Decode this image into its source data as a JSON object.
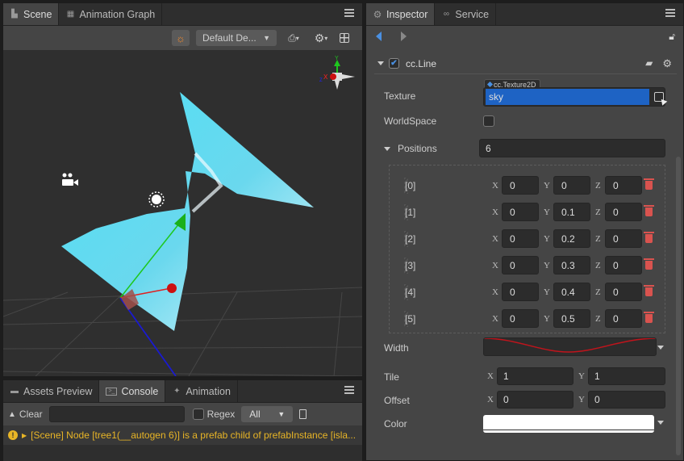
{
  "scene_panel": {
    "tabs": [
      {
        "label": "Scene",
        "icon": "scene-icon",
        "active": true
      },
      {
        "label": "Animation Graph",
        "icon": "animation-graph-icon",
        "active": false
      }
    ],
    "toolbar": {
      "light_icon": "sun-icon",
      "layout_select": "Default De...",
      "camera_menu_icon": "camera-icon",
      "settings_icon": "gear-icon",
      "layout_icon": "grid-icon"
    },
    "gizmo": {
      "y_label": "Y",
      "x_label": "X",
      "z_label": "Z"
    }
  },
  "console_panel": {
    "tabs": [
      {
        "label": "Assets Preview",
        "icon": "folder-icon",
        "active": false
      },
      {
        "label": "Console",
        "icon": "console-icon",
        "active": true
      },
      {
        "label": "Animation",
        "icon": "animation-icon",
        "active": false
      }
    ],
    "clear_label": "Clear",
    "search_value": "",
    "regex_label": "Regex",
    "regex_checked": false,
    "filter_value": "All",
    "logs": [
      {
        "level": "warning",
        "text": "[Scene] Node [tree1(__autogen 6)] is a prefab child of prefabInstance [isla..."
      }
    ]
  },
  "inspector": {
    "tabs": [
      {
        "label": "Inspector",
        "icon": "gear-icon",
        "active": true
      },
      {
        "label": "Service",
        "icon": "link-icon",
        "active": false
      }
    ],
    "component": {
      "name": "cc.Line",
      "enabled": true,
      "texture": {
        "label": "Texture",
        "type_tag": "cc.Texture2D",
        "value": "sky"
      },
      "world_space": {
        "label": "WorldSpace",
        "checked": false
      },
      "positions": {
        "label": "Positions",
        "count": "6",
        "items": [
          {
            "index": "[0]",
            "x": "0",
            "y": "0",
            "z": "0"
          },
          {
            "index": "[1]",
            "x": "0",
            "y": "0.1",
            "z": "0"
          },
          {
            "index": "[2]",
            "x": "0",
            "y": "0.2",
            "z": "0"
          },
          {
            "index": "[3]",
            "x": "0",
            "y": "0.3",
            "z": "0"
          },
          {
            "index": "[4]",
            "x": "0",
            "y": "0.4",
            "z": "0"
          },
          {
            "index": "[5]",
            "x": "0",
            "y": "0.5",
            "z": "0"
          }
        ]
      },
      "width": {
        "label": "Width",
        "curve_color": "#c0141c"
      },
      "tile": {
        "label": "Tile",
        "x": "1",
        "y": "1"
      },
      "offset": {
        "label": "Offset",
        "x": "0",
        "y": "0"
      },
      "color": {
        "label": "Color",
        "value": "#ffffff"
      }
    },
    "axis_labels": {
      "x": "X",
      "y": "Y",
      "z": "Z"
    }
  }
}
